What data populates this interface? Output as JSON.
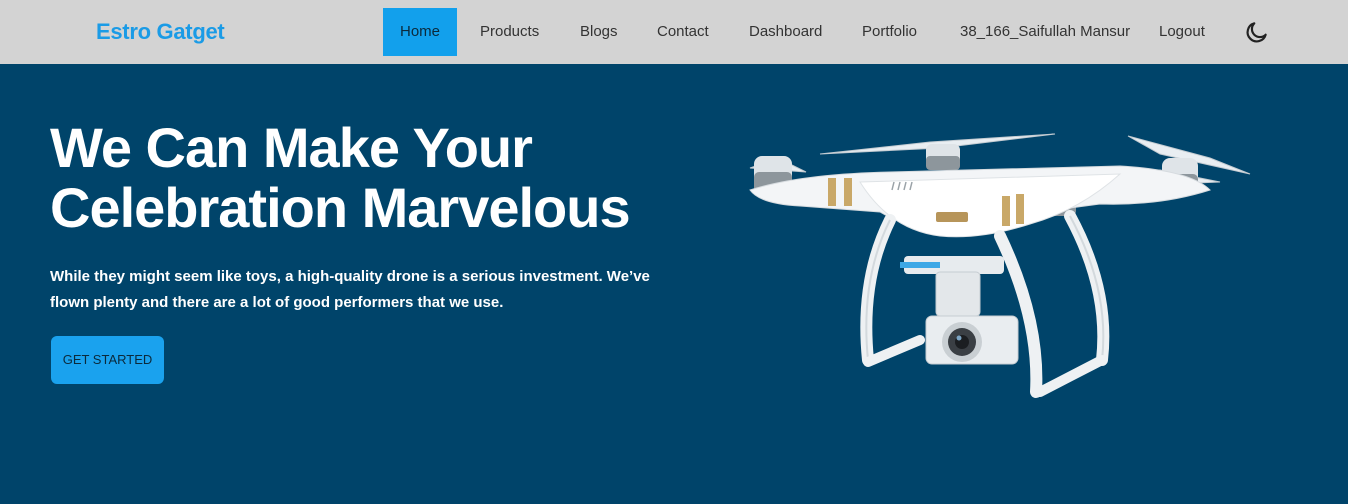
{
  "navbar": {
    "brand": "Estro Gatget",
    "items": [
      {
        "label": "Home",
        "active": true
      },
      {
        "label": "Products"
      },
      {
        "label": "Blogs"
      },
      {
        "label": "Contact"
      },
      {
        "label": "Dashboard"
      },
      {
        "label": "Portfolio"
      },
      {
        "label": "38_166_Saifullah Mansur"
      },
      {
        "label": "Logout"
      }
    ],
    "theme_icon": "moon-icon"
  },
  "hero": {
    "title_line1": "We Can Make Your",
    "title_line2": "Celebration Marvelous",
    "description": "While they might seem like toys, a high-quality drone is a serious investment. We’ve flown plenty and there are a lot of good performers that we use.",
    "cta_label": "GET STARTED",
    "image": "drone-image"
  },
  "colors": {
    "navbar_bg": "#d3d3d3",
    "brand": "#1a9be6",
    "active_nav": "#12a0ec",
    "hero_bg": "#00446a",
    "cta_bg": "#1aa2ee"
  }
}
